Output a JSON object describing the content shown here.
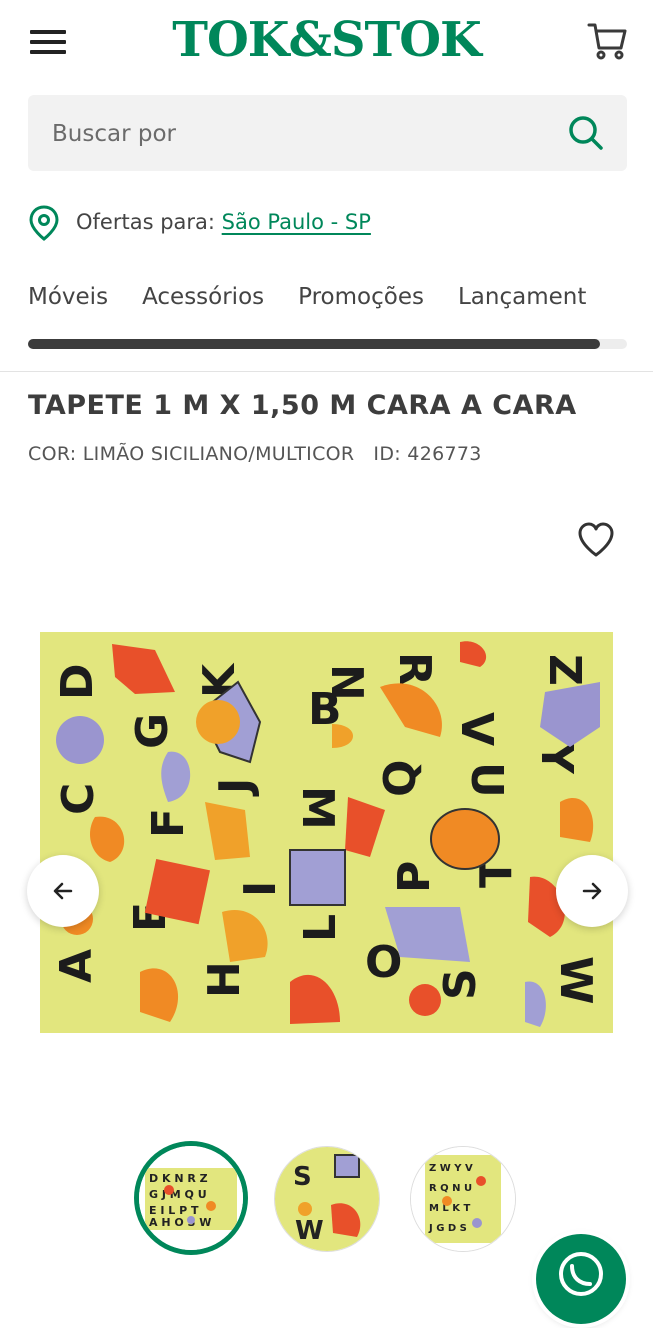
{
  "header": {
    "logo_text": "TOK&STOK",
    "menu_icon": "hamburger-menu-icon",
    "cart_icon": "cart-icon"
  },
  "search": {
    "placeholder": "Buscar por",
    "icon": "search-icon"
  },
  "location": {
    "label": "Ofertas para:",
    "city": "São Paulo - SP",
    "icon": "location-pin-icon"
  },
  "categories": [
    "Móveis",
    "Acessórios",
    "Promoções",
    "Lançament"
  ],
  "categories_scroll_fraction": 0.955,
  "product": {
    "title": "TAPETE 1 M X 1,50 M CARA A CARA",
    "subtitle": "COR: LIMÃO SICILIANO/MULTICOR   ID: 426773",
    "favorite_icon": "heart-outline-icon",
    "prev_icon": "arrow-left-icon",
    "next_icon": "arrow-right-icon",
    "thumbnails_count": 3,
    "selected_thumbnail": 1
  },
  "colors": {
    "brand_green": "#00875a",
    "rug_background": "#e2e67e",
    "text_dark": "#3d3d3d"
  },
  "floating": {
    "icon": "whatsapp-icon"
  }
}
